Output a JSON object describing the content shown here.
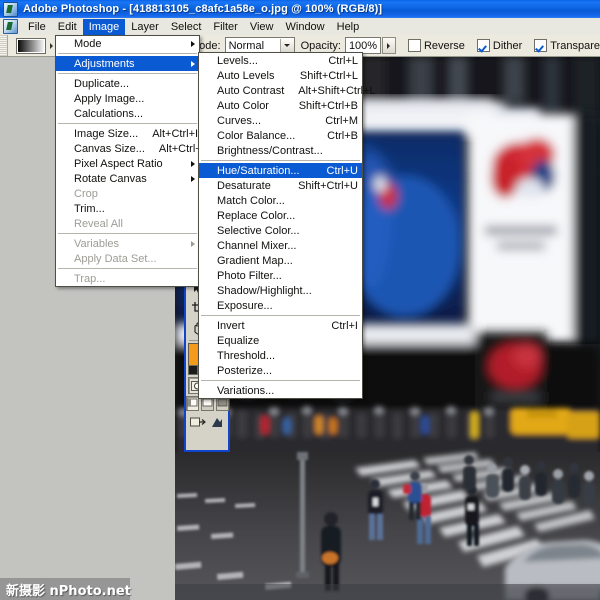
{
  "window": {
    "app_name": "Adobe Photoshop",
    "title": "Adobe Photoshop - [418813105_c8afc1a58e_o.jpg @ 100% (RGB/8)]",
    "document_name": "418813105_c8afc1a58e_o.jpg",
    "zoom": "100%",
    "color_mode": "RGB/8",
    "icon": "photoshop-logo-icon"
  },
  "menubar": {
    "icon": "document-icon",
    "items": [
      {
        "label": "File",
        "active": false
      },
      {
        "label": "Edit",
        "active": false
      },
      {
        "label": "Image",
        "active": true
      },
      {
        "label": "Layer",
        "active": false
      },
      {
        "label": "Select",
        "active": false
      },
      {
        "label": "Filter",
        "active": false
      },
      {
        "label": "View",
        "active": false
      },
      {
        "label": "Window",
        "active": false
      },
      {
        "label": "Help",
        "active": false
      }
    ]
  },
  "options_bar": {
    "tool": "gradient-tool",
    "gradient_preset_label": "black-white-gradient",
    "gradient_types": [
      "linear-gradient",
      "radial-gradient",
      "angle-gradient",
      "reflected-gradient",
      "diamond-gradient"
    ],
    "gradient_type_selected": 0,
    "mode_label": "Mode:",
    "mode_value": "Normal",
    "opacity_label": "Opacity:",
    "opacity_value": "100%",
    "reverse_label": "Reverse",
    "reverse_checked": false,
    "dither_label": "Dither",
    "dither_checked": true,
    "transparency_label": "Transparency",
    "transparency_checked": true
  },
  "toolbox": {
    "tools": [
      "move-tool",
      "lasso-tool",
      "crop-tool",
      "healing-brush-tool",
      "hand-tool",
      "eyedropper-tool"
    ],
    "foreground_color": "#f49b1c",
    "background_color": "#8f8d85",
    "default_colors_label": "default-colors",
    "mask_modes": [
      "standard-mask-mode",
      "quick-mask-mode"
    ],
    "screen_modes": [
      "standard-screen-mode",
      "full-screen-with-menubar",
      "full-screen-mode"
    ],
    "jump_to_imageready_label": "jump-to-imageready"
  },
  "image_menu": {
    "items": [
      {
        "label": "Mode",
        "accel": "",
        "submenu": true,
        "disabled": false,
        "highlight": false
      },
      {
        "sep": true
      },
      {
        "label": "Adjustments",
        "accel": "",
        "submenu": true,
        "disabled": false,
        "highlight": true
      },
      {
        "sep": true
      },
      {
        "label": "Duplicate...",
        "accel": "",
        "submenu": false,
        "disabled": false,
        "highlight": false
      },
      {
        "label": "Apply Image...",
        "accel": "",
        "submenu": false,
        "disabled": false,
        "highlight": false
      },
      {
        "label": "Calculations...",
        "accel": "",
        "submenu": false,
        "disabled": false,
        "highlight": false
      },
      {
        "sep": true
      },
      {
        "label": "Image Size...",
        "accel": "Alt+Ctrl+I",
        "submenu": false,
        "disabled": false,
        "highlight": false
      },
      {
        "label": "Canvas Size...",
        "accel": "Alt+Ctrl+C",
        "submenu": false,
        "disabled": false,
        "highlight": false
      },
      {
        "label": "Pixel Aspect Ratio",
        "accel": "",
        "submenu": true,
        "disabled": false,
        "highlight": false
      },
      {
        "label": "Rotate Canvas",
        "accel": "",
        "submenu": true,
        "disabled": false,
        "highlight": false
      },
      {
        "label": "Crop",
        "accel": "",
        "submenu": false,
        "disabled": true,
        "highlight": false
      },
      {
        "label": "Trim...",
        "accel": "",
        "submenu": false,
        "disabled": false,
        "highlight": false
      },
      {
        "label": "Reveal All",
        "accel": "",
        "submenu": false,
        "disabled": true,
        "highlight": false
      },
      {
        "sep": true
      },
      {
        "label": "Variables",
        "accel": "",
        "submenu": true,
        "disabled": true,
        "highlight": false
      },
      {
        "label": "Apply Data Set...",
        "accel": "",
        "submenu": false,
        "disabled": true,
        "highlight": false
      },
      {
        "sep": true
      },
      {
        "label": "Trap...",
        "accel": "",
        "submenu": false,
        "disabled": true,
        "highlight": false
      }
    ]
  },
  "adjustments_menu": {
    "items": [
      {
        "label": "Levels...",
        "accel": "Ctrl+L",
        "disabled": false,
        "highlight": false
      },
      {
        "label": "Auto Levels",
        "accel": "Shift+Ctrl+L",
        "disabled": false,
        "highlight": false
      },
      {
        "label": "Auto Contrast",
        "accel": "Alt+Shift+Ctrl+L",
        "disabled": false,
        "highlight": false
      },
      {
        "label": "Auto Color",
        "accel": "Shift+Ctrl+B",
        "disabled": false,
        "highlight": false
      },
      {
        "label": "Curves...",
        "accel": "Ctrl+M",
        "disabled": false,
        "highlight": false
      },
      {
        "label": "Color Balance...",
        "accel": "Ctrl+B",
        "disabled": false,
        "highlight": false
      },
      {
        "label": "Brightness/Contrast...",
        "accel": "",
        "disabled": false,
        "highlight": false
      },
      {
        "sep": true
      },
      {
        "label": "Hue/Saturation...",
        "accel": "Ctrl+U",
        "disabled": false,
        "highlight": true
      },
      {
        "label": "Desaturate",
        "accel": "Shift+Ctrl+U",
        "disabled": false,
        "highlight": false
      },
      {
        "label": "Match Color...",
        "accel": "",
        "disabled": false,
        "highlight": false
      },
      {
        "label": "Replace Color...",
        "accel": "",
        "disabled": false,
        "highlight": false
      },
      {
        "label": "Selective Color...",
        "accel": "",
        "disabled": false,
        "highlight": false
      },
      {
        "label": "Channel Mixer...",
        "accel": "",
        "disabled": false,
        "highlight": false
      },
      {
        "label": "Gradient Map...",
        "accel": "",
        "disabled": false,
        "highlight": false
      },
      {
        "label": "Photo Filter...",
        "accel": "",
        "disabled": false,
        "highlight": false
      },
      {
        "label": "Shadow/Highlight...",
        "accel": "",
        "disabled": false,
        "highlight": false
      },
      {
        "label": "Exposure...",
        "accel": "",
        "disabled": false,
        "highlight": false
      },
      {
        "sep": true
      },
      {
        "label": "Invert",
        "accel": "Ctrl+I",
        "disabled": false,
        "highlight": false
      },
      {
        "label": "Equalize",
        "accel": "",
        "disabled": false,
        "highlight": false
      },
      {
        "label": "Threshold...",
        "accel": "",
        "disabled": false,
        "highlight": false
      },
      {
        "label": "Posterize...",
        "accel": "",
        "disabled": false,
        "highlight": false
      },
      {
        "sep": true
      },
      {
        "label": "Variations...",
        "accel": "",
        "disabled": false,
        "highlight": false
      }
    ]
  },
  "watermark": {
    "text": "新摄影 nPhoto.net"
  },
  "colors": {
    "title_blue": "#0a5ad4",
    "highlight_blue": "#0a5ad4",
    "chrome_gray": "#ece ad f",
    "toolbox_border": "#1144cc",
    "foreground": "#f49b1c"
  }
}
